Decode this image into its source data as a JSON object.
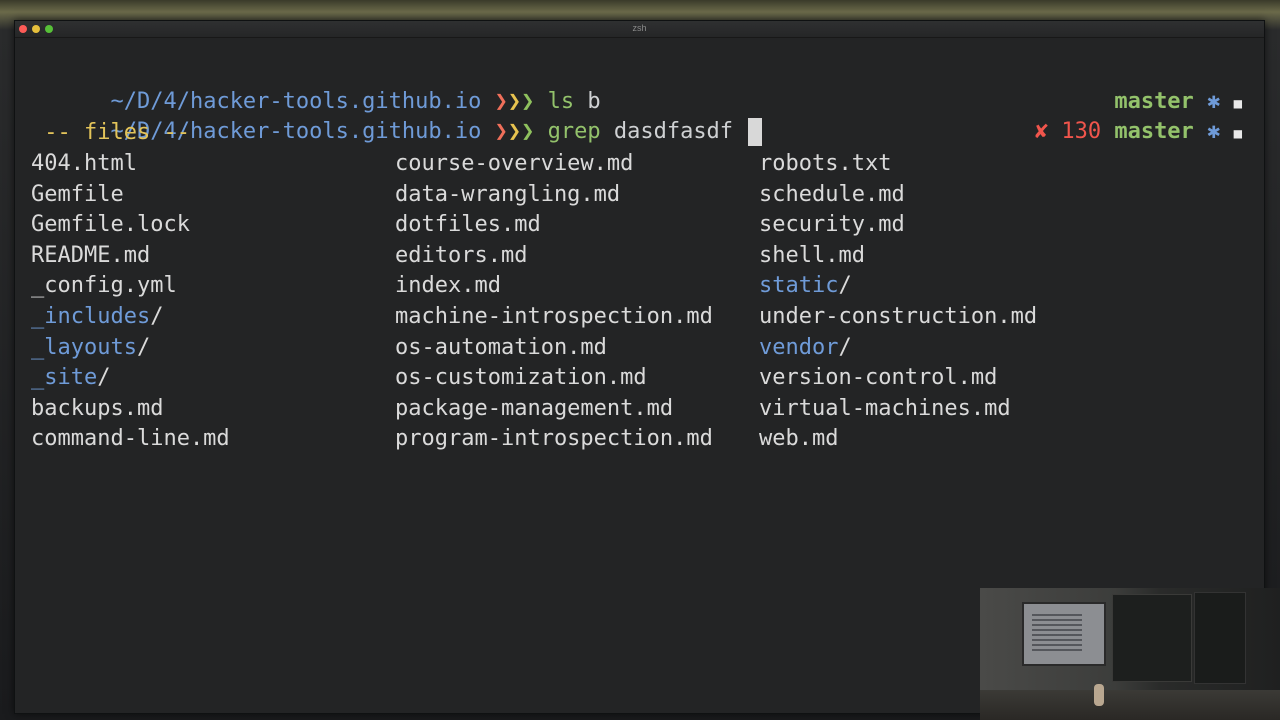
{
  "window": {
    "title": "zsh",
    "traffic_lights": [
      "close",
      "minimize",
      "maximize"
    ]
  },
  "prompt": {
    "path": "~/D/4/hacker-tools.github.io",
    "arrows": [
      "❯",
      "❯",
      "❯"
    ]
  },
  "lines": [
    {
      "command": "ls",
      "args": "b",
      "right": {
        "branch": "master",
        "star": "✱",
        "square": "■"
      }
    },
    {
      "command": "grep",
      "args": "dasdfasdf",
      "right": {
        "error_mark": "✘",
        "exit_code": "130",
        "branch": "master",
        "star": "✱",
        "square": "■"
      }
    }
  ],
  "completion": {
    "header": " -- files --",
    "columns": [
      [
        {
          "name": "404.html"
        },
        {
          "name": "Gemfile"
        },
        {
          "name": "Gemfile.lock"
        },
        {
          "name": "README.md"
        },
        {
          "name": "_config.yml"
        },
        {
          "name": "_includes",
          "dir": true
        },
        {
          "name": "_layouts",
          "dir": true
        },
        {
          "name": "_site",
          "dir": true
        },
        {
          "name": "backups.md"
        },
        {
          "name": "command-line.md"
        }
      ],
      [
        {
          "name": "course-overview.md"
        },
        {
          "name": "data-wrangling.md"
        },
        {
          "name": "dotfiles.md"
        },
        {
          "name": "editors.md"
        },
        {
          "name": "index.md"
        },
        {
          "name": "machine-introspection.md"
        },
        {
          "name": "os-automation.md"
        },
        {
          "name": "os-customization.md"
        },
        {
          "name": "package-management.md"
        },
        {
          "name": "program-introspection.md"
        }
      ],
      [
        {
          "name": "robots.txt"
        },
        {
          "name": "schedule.md"
        },
        {
          "name": "security.md"
        },
        {
          "name": "shell.md"
        },
        {
          "name": "static",
          "dir": true
        },
        {
          "name": "under-construction.md"
        },
        {
          "name": "vendor",
          "dir": true
        },
        {
          "name": "version-control.md"
        },
        {
          "name": "virtual-machines.md"
        },
        {
          "name": "web.md"
        }
      ]
    ],
    "dir_suffix": "/"
  },
  "colors": {
    "path": "#6f9bd8",
    "command": "#93c26b",
    "branch": "#93c26b",
    "error": "#f0554c",
    "header": "#e3c45a",
    "directory": "#6f9bd8",
    "background": "#232425"
  }
}
